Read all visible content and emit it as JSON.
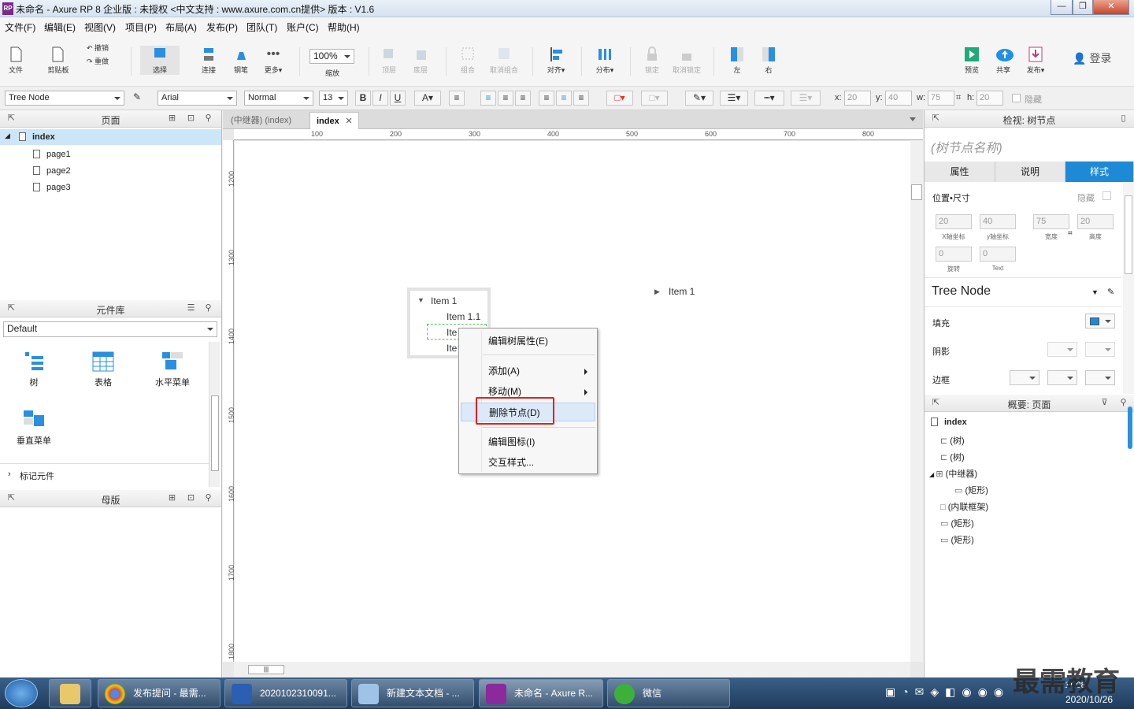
{
  "window": {
    "title": "未命名 - Axure RP 8 企业版 : 未授权      <中文支持 : www.axure.com.cn提供> 版本 : V1.6",
    "app_badge": "RP"
  },
  "menu": [
    "文件(F)",
    "编辑(E)",
    "视图(V)",
    "项目(P)",
    "布局(A)",
    "发布(P)",
    "团队(T)",
    "账户(C)",
    "帮助(H)"
  ],
  "toolbar": {
    "file": "文件",
    "clipboard": "剪贴板",
    "undo": "撤销",
    "redo": "重做",
    "select": "选择",
    "connect": "连接",
    "pen": "钢笔",
    "more": "更多▾",
    "zoom_value": "100%",
    "zoom": "缩放",
    "top": "顶层",
    "bottom": "底层",
    "group": "组合",
    "ungroup": "取消组合",
    "align": "对齐▾",
    "distribute": "分布▾",
    "lock": "锁定",
    "unlock": "取消锁定",
    "left": "左",
    "right": "右",
    "preview": "预览",
    "share": "共享",
    "publish": "发布▾",
    "login": "登录"
  },
  "format": {
    "widget_style": "Tree Node",
    "font": "Arial",
    "font_style": "Normal",
    "font_size": "13",
    "bold": "B",
    "italic": "I",
    "underline": "U",
    "x_label": "x:",
    "x": "20",
    "y_label": "y:",
    "y": "40",
    "w_label": "w:",
    "w": "75",
    "h_label": "h:",
    "h": "20",
    "hidden": "隐藏"
  },
  "pages_panel": {
    "title": "页面",
    "items": [
      "index",
      "page1",
      "page2",
      "page3"
    ]
  },
  "library_panel": {
    "title": "元件库",
    "selected": "Default",
    "items": [
      "树",
      "表格",
      "水平菜单",
      "垂直菜单"
    ],
    "footer": "标记元件"
  },
  "masters_panel": {
    "title": "母版"
  },
  "tabs": [
    "(中继器) (index)",
    "index"
  ],
  "ruler_h": [
    "100",
    "200",
    "300",
    "400",
    "500",
    "600",
    "700",
    "800"
  ],
  "ruler_v": [
    "1200",
    "1300",
    "1400",
    "1500",
    "1600",
    "1700",
    "1800"
  ],
  "tree_widget": {
    "root": "Item 1",
    "children": [
      "Item 1.1",
      "Ite",
      "Ite"
    ]
  },
  "tree_widget2": {
    "root": "Item 1"
  },
  "context_menu": [
    "编辑树属性(E)",
    "添加(A)",
    "移动(M)",
    "删除节点(D)",
    "编辑图标(I)",
    "交互样式..."
  ],
  "inspector": {
    "title": "检视: 树节点",
    "name_placeholder": "(树节点名称)",
    "tabs": [
      "属性",
      "说明",
      "样式"
    ],
    "pos_size": "位置•尺寸",
    "hidden": "隐藏",
    "x": "20",
    "y": "40",
    "w": "75",
    "h": "20",
    "x_sub": "X轴坐标",
    "y_sub": "y轴坐标",
    "w_sub": "宽度",
    "h_sub": "高度",
    "rotate": "0",
    "rotate_sub": "旋转",
    "text_rotate": "0",
    "text_sub": "Text",
    "style_name": "Tree Node",
    "fill": "填充",
    "shadow": "阴影",
    "border": "边框",
    "fill_color": "#1e8ad6"
  },
  "outline": {
    "title": "概要: 页面",
    "items": [
      "index",
      "(树)",
      "(树)",
      "(中继器)",
      "(矩形)",
      "(内联框架)",
      "(矩形)",
      "(矩形)"
    ]
  },
  "taskbar": {
    "items": [
      "发布提问 - 最需...",
      "2020102310091...",
      "新建文本文档 - ...",
      "未命名 - Axure R...",
      "微信"
    ],
    "date": "2020/10/26",
    "time": "11:08",
    "watermark": "最需教育"
  }
}
